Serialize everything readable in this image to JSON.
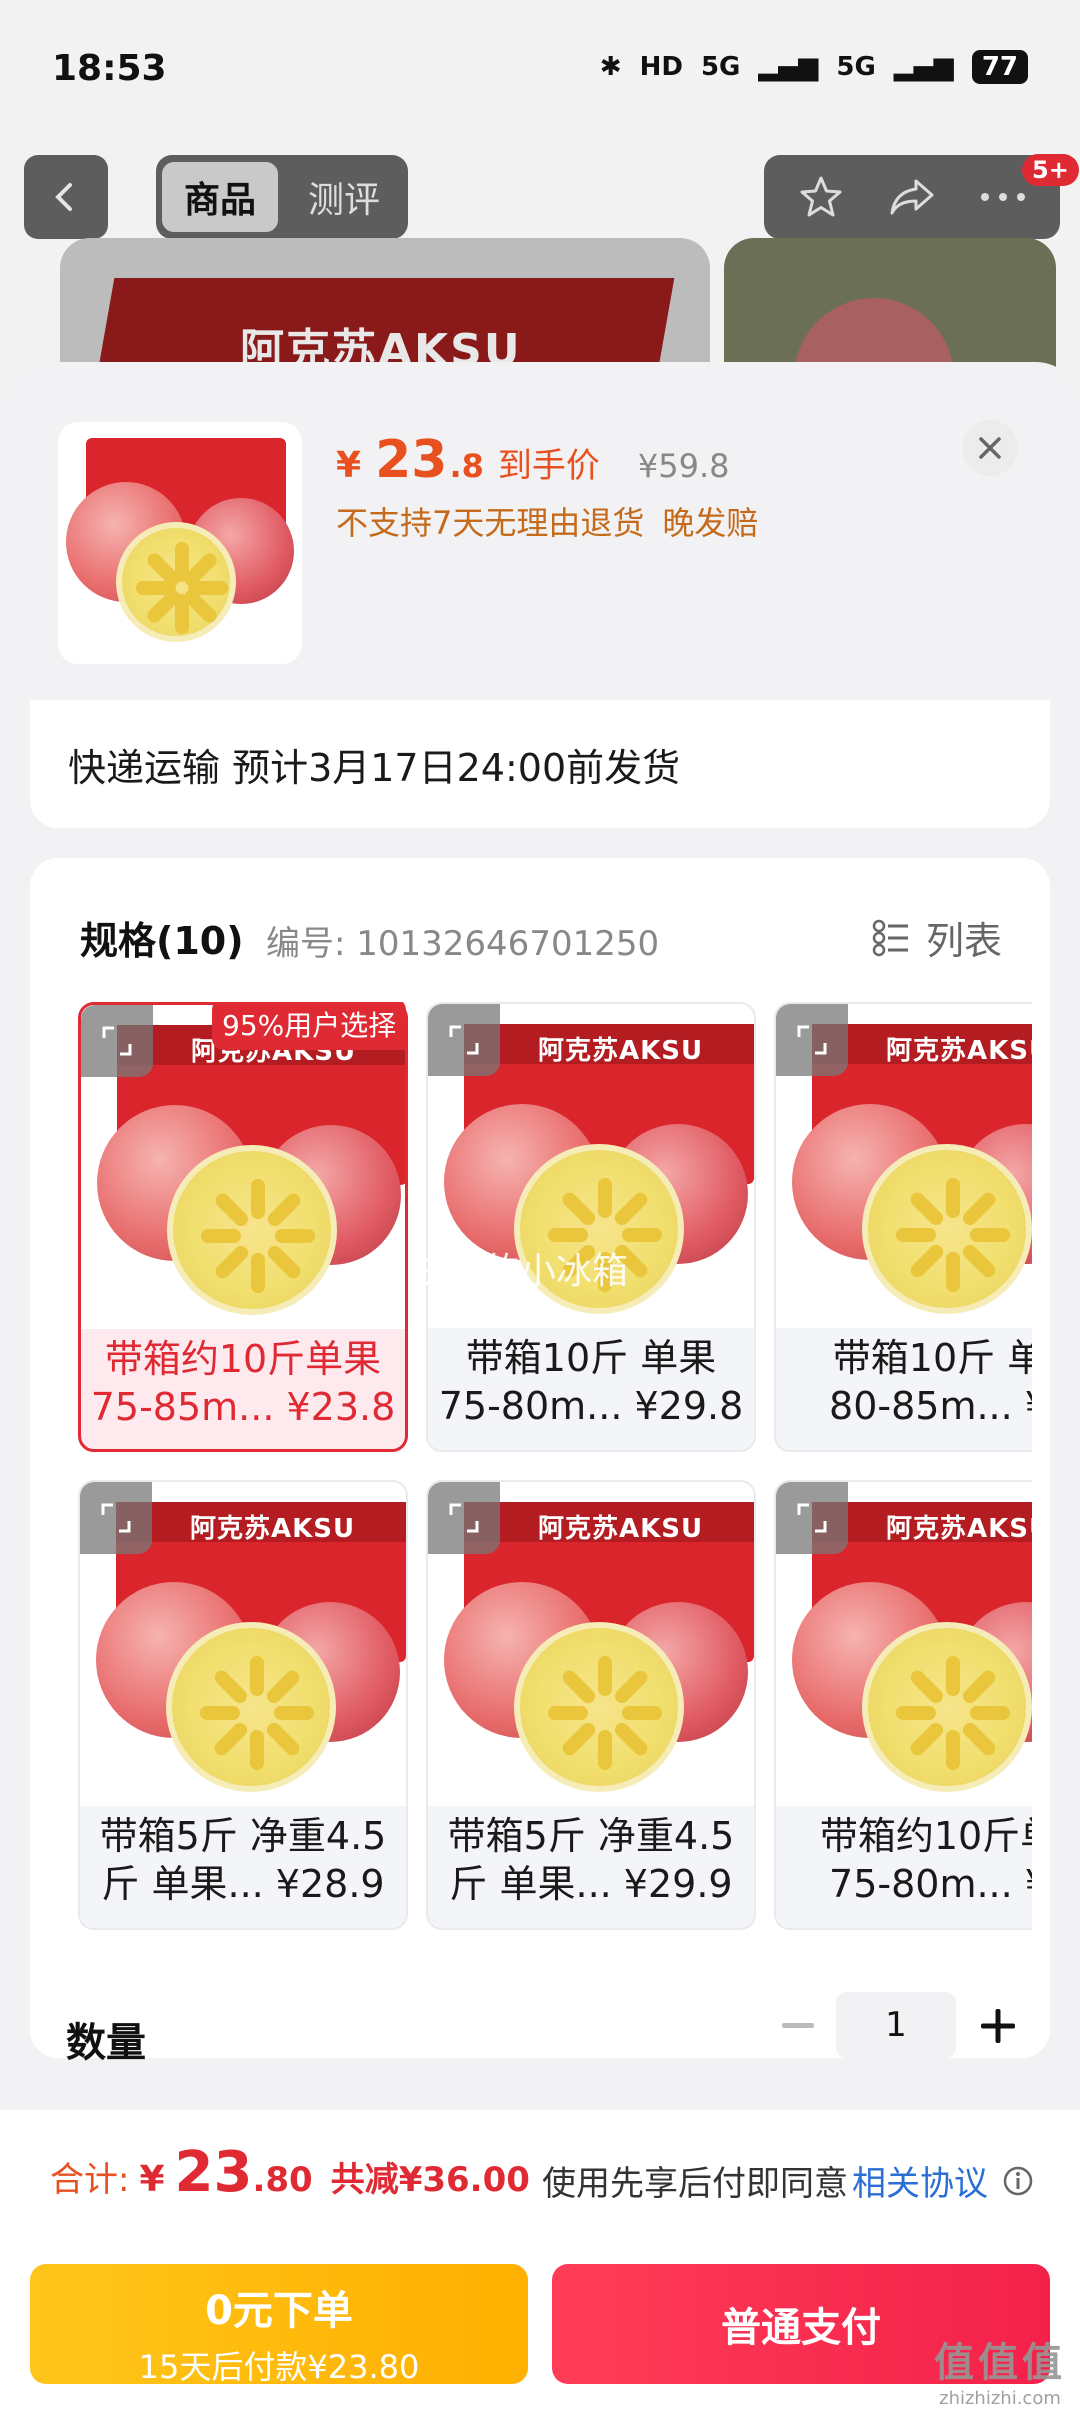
{
  "status": {
    "time": "18:53",
    "network1": "5G",
    "network2": "5G",
    "hd": "HD",
    "battery": "77"
  },
  "nav": {
    "tabs": [
      "商品",
      "测评"
    ],
    "badge": "5+"
  },
  "bg": {
    "box_text": "阿克苏AKSU"
  },
  "sheet": {
    "price_yen": "¥",
    "price_int": "23",
    "price_dec": ".8",
    "price_tag": "到手价",
    "orig_price": "¥59.8",
    "promise1": "不支持7天无理由退货",
    "promise2": "晚发赔",
    "shipping": "快递运输 预计3月17日24:00前发货",
    "spec_title": "规格(10)",
    "spec_code": "编号: 10132646701250",
    "list_label": "列表",
    "popular_badge": "95%用户选择",
    "watermark": "快乐的小冰箱",
    "box_text": "阿克苏AKSU",
    "items": [
      {
        "line1": "带箱约10斤单果",
        "line2": "75-85m... ¥23.8"
      },
      {
        "line1": "带箱10斤 单果",
        "line2": "75-80m... ¥29.8"
      },
      {
        "line1": "带箱10斤 单",
        "line2": "80-85m... ¥"
      },
      {
        "line1": "带箱5斤 净重4.5",
        "line2": "斤 单果... ¥28.9"
      },
      {
        "line1": "带箱5斤 净重4.5",
        "line2": "斤 单果... ¥29.9"
      },
      {
        "line1": "带箱约10斤单",
        "line2": "75-80m... ¥"
      }
    ],
    "qty_label": "数量",
    "qty_value": "1"
  },
  "footer": {
    "total_label": "合计:",
    "total_yen": "¥",
    "total_int": "23",
    "total_dec": ".80",
    "total_save": "共减¥36.00",
    "agree_text": "使用先享后付即同意",
    "agree_link": "相关协议",
    "btn_zero_main": "0元下单",
    "btn_zero_sub": "15天后付款¥23.80",
    "btn_pay": "普通支付"
  },
  "site_mark": {
    "big": "值值值",
    "small": "zhizhizhi.com"
  },
  "colors": {
    "accent": "#e02a33",
    "orange": "#e8501f",
    "link": "#2b6fd6",
    "yellow_btn": "#ffb000"
  }
}
